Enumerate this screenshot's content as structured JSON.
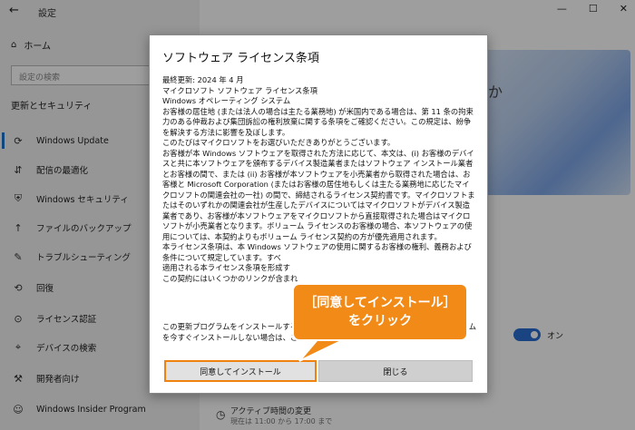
{
  "window": {
    "title": "設定",
    "back_icon": "←",
    "controls": [
      "—",
      "☐",
      "✕"
    ]
  },
  "sidebar": {
    "home_label": "ホーム",
    "search_placeholder": "設定の検索",
    "section_title": "更新とセキュリティ",
    "items": [
      {
        "icon": "⟳",
        "label": "Windows Update"
      },
      {
        "icon": "⇵",
        "label": "配信の最適化"
      },
      {
        "icon": "⛨",
        "label": "Windows セキュリティ"
      },
      {
        "icon": "↑",
        "label": "ファイルのバックアップ"
      },
      {
        "icon": "✎",
        "label": "トラブルシューティング"
      },
      {
        "icon": "⟲",
        "label": "回復"
      },
      {
        "icon": "⊙",
        "label": "ライセンス認証"
      },
      {
        "icon": "⌖",
        "label": "デバイスの検索"
      },
      {
        "icon": "⚒",
        "label": "開発者向け"
      },
      {
        "icon": "☺",
        "label": "Windows Insider Program"
      }
    ]
  },
  "background": {
    "hero_text": "か",
    "toggle_label": "オン",
    "active_hours_title": "アクティブ時間の変更",
    "active_hours_sub": "現在は 11:00 から 17:00 まで"
  },
  "dialog": {
    "title": "ソフトウェア ライセンス条項",
    "body": [
      "最終更新: 2024 年 4 月",
      "マイクロソフト ソフトウェア ライセンス条項",
      "Windows オペレーティング システム",
      "お客様の居住地 (または法人の場合は主たる業務地) が米国内である場合は、第 11 条の拘束力のある仲裁および集団訴訟の権利放棄に関する条項をご確認ください。この規定は、紛争を解決する方法に影響を及ぼします。",
      "このたびはマイクロソフトをお選びいただきありがとうございます。",
      "お客様が本 Windows ソフトウェアを取得された方法に応じて、本文は、(i) お客様のデバイスと共に本ソフトウェアを頒布するデバイス製造業者またはソフトウェア インストール業者とお客様の間で、または (ii) お客様が本ソフトウェアを小売業者から取得された場合は、お客様と Microsoft Corporation (またはお客様の居住地もしくは主たる業務地に応じたマイクロソフトの関連会社の一社) の間で、締結されるライセンス契約書です。マイクロソフトまたはそのいずれかの関連会社が生産したデバイスについてはマイクロソフトがデバイス製造業者であり、お客様が本ソフトウェアをマイクロソフトから直接取得された場合はマイクロソフトが小売業者となります。ボリューム ライセンスのお客様の場合、本ソフトウェアの使用については、本契約よりもボリューム ライセンス契約の方が優先適用されます。",
      "本ライセンス条項は、本 Windows ソフトウェアの使用に関するお客様の権利、義務および条件について規定しています。すべ",
      "適用される本ライセンス条項を形成す",
      "この契約にはいくつかのリンクが含まれ"
    ],
    "bottom_text_1": "この更新プログラムをインストールするに",
    "bottom_text_1b": "ム",
    "bottom_text_2": "を今すぐインストールしない場合は、この",
    "agree_label": "同意してインストール",
    "close_label": "閉じる"
  },
  "callout": {
    "line1": "［同意してインストール］",
    "line2": "をクリック"
  }
}
